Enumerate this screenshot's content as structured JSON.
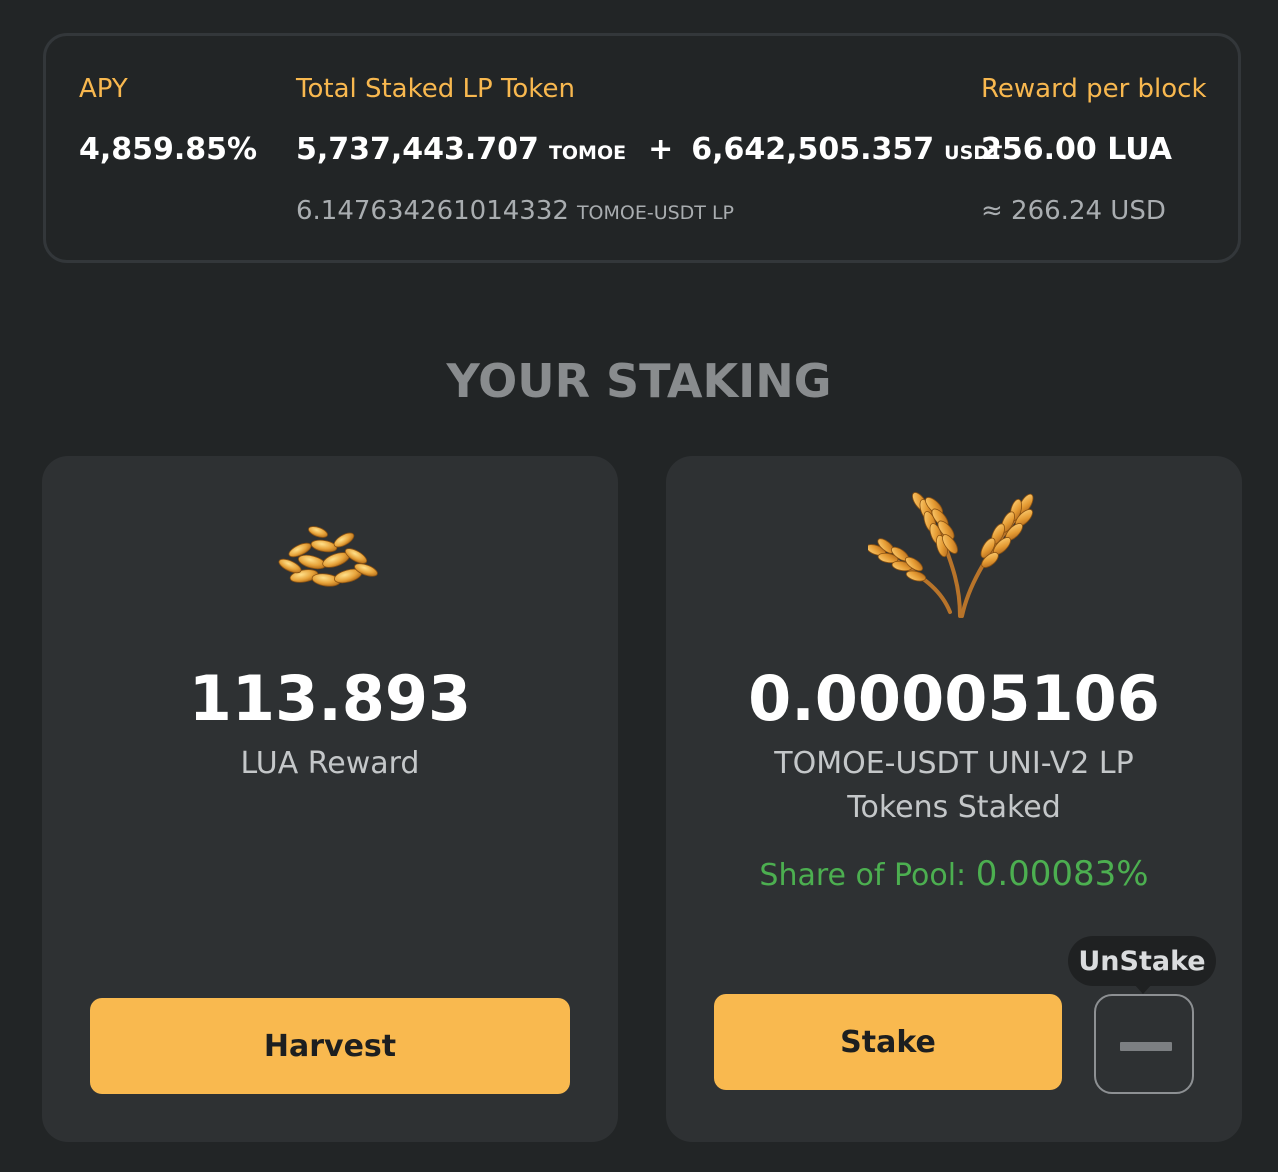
{
  "stats": {
    "apy": {
      "label": "APY",
      "value": "4,859.85%"
    },
    "total_staked": {
      "label": "Total Staked LP Token",
      "tomoe_amount": "5,737,443.707",
      "tomoe_unit": "TOMOE",
      "plus": "+",
      "usdt_amount": "6,642,505.357",
      "usdt_unit": "USDT",
      "lp_amount": "6.147634261014332",
      "lp_unit": "TOMOE-USDT LP"
    },
    "reward": {
      "label": "Reward per block",
      "value": "256.00 LUA",
      "usd": "≈ 266.24 USD"
    }
  },
  "section_title": "YOUR STAKING",
  "harvest_card": {
    "icon": "grain-pile-icon",
    "amount": "113.893",
    "caption": "LUA Reward",
    "button": "Harvest"
  },
  "stake_card": {
    "icon": "wheat-icon",
    "amount": "0.00005106",
    "caption_line1": "TOMOE-USDT UNI-V2 LP",
    "caption_line2": "Tokens Staked",
    "share_label": "Share of Pool:",
    "share_value": "0.00083%",
    "button": "Stake",
    "tooltip": "UnStake",
    "unstake_icon": "minus-icon"
  },
  "colors": {
    "background": "#222526",
    "card": "#2e3133",
    "accent": "#f9b94f",
    "label": "#f8b84f",
    "success": "#4caf50"
  }
}
